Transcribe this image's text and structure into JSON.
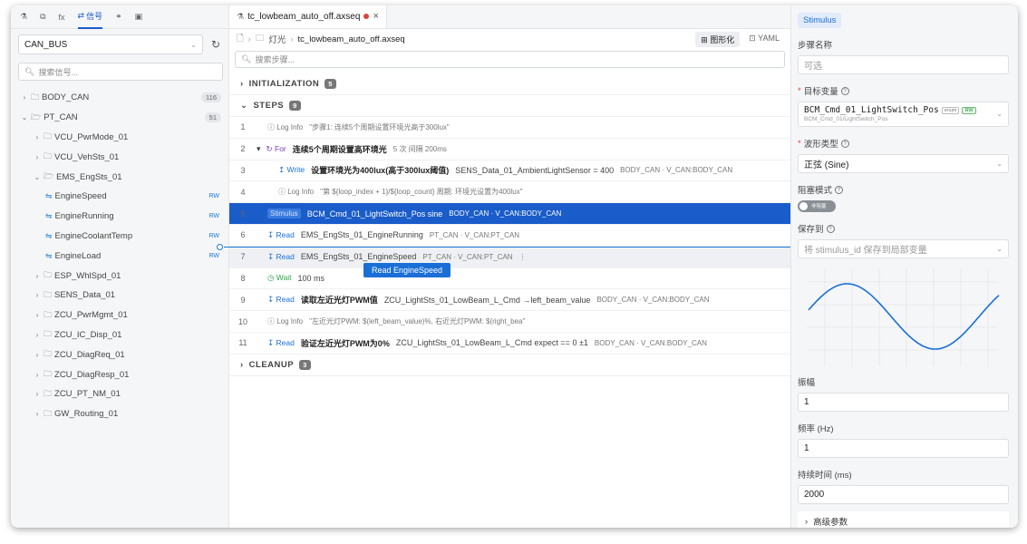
{
  "left": {
    "tabs": [
      {
        "icon": "flask-icon",
        "glyph": "⚗",
        "label": ""
      },
      {
        "icon": "copy-icon",
        "glyph": "⧉",
        "label": ""
      },
      {
        "icon": "function-icon",
        "glyph": "fx",
        "label": ""
      },
      {
        "icon": "signal-icon",
        "glyph": "⇄",
        "label": "信号"
      },
      {
        "icon": "share-icon",
        "glyph": "⚭",
        "label": ""
      },
      {
        "icon": "image-icon",
        "glyph": "▣",
        "label": ""
      }
    ],
    "bus_value": "CAN_BUS",
    "search_placeholder": "搜索信号...",
    "tree": [
      {
        "kind": "folder",
        "chev": "›",
        "label": "BODY_CAN",
        "count": "116",
        "indent": 0
      },
      {
        "kind": "folder-open",
        "chev": "⌄",
        "label": "PT_CAN",
        "count": "51",
        "indent": 0
      },
      {
        "kind": "folder",
        "chev": "›",
        "label": "VCU_PwrMode_01",
        "indent": 1
      },
      {
        "kind": "folder",
        "chev": "›",
        "label": "VCU_VehSts_01",
        "indent": 1
      },
      {
        "kind": "folder-open",
        "chev": "⌄",
        "label": "EMS_EngSts_01",
        "indent": 1
      },
      {
        "kind": "signal",
        "label": "EngineSpeed",
        "rw": "RW",
        "indent": 2
      },
      {
        "kind": "signal",
        "label": "EngineRunning",
        "rw": "RW",
        "indent": 2
      },
      {
        "kind": "signal",
        "label": "EngineCoolantTemp",
        "rw": "RW",
        "indent": 2
      },
      {
        "kind": "signal",
        "label": "EngineLoad",
        "rw": "RW",
        "indent": 2
      },
      {
        "kind": "folder",
        "chev": "›",
        "label": "ESP_WhlSpd_01",
        "indent": 1
      },
      {
        "kind": "folder",
        "chev": "›",
        "label": "SENS_Data_01",
        "indent": 1
      },
      {
        "kind": "folder",
        "chev": "›",
        "label": "ZCU_PwrMgmt_01",
        "indent": 1
      },
      {
        "kind": "folder",
        "chev": "›",
        "label": "ZCU_IC_Disp_01",
        "indent": 1
      },
      {
        "kind": "folder",
        "chev": "›",
        "label": "ZCU_DiagReq_01",
        "indent": 1
      },
      {
        "kind": "folder",
        "chev": "›",
        "label": "ZCU_DiagResp_01",
        "indent": 1
      },
      {
        "kind": "folder",
        "chev": "›",
        "label": "ZCU_PT_NM_01",
        "indent": 1
      },
      {
        "kind": "folder",
        "chev": "›",
        "label": "GW_Routing_01",
        "indent": 1
      }
    ]
  },
  "mid": {
    "file_tab": "tc_lowbeam_auto_off.axseq",
    "breadcrumb": [
      "灯光",
      "tc_lowbeam_auto_off.axseq"
    ],
    "view_graph": "图形化",
    "view_yaml": "YAML",
    "step_search_placeholder": "搜索步骤...",
    "sections": {
      "init": {
        "label": "INITIALIZATION",
        "count": "5"
      },
      "steps": {
        "label": "STEPS",
        "count": "9"
      },
      "cleanup": {
        "label": "CLEANUP",
        "count": "3"
      }
    },
    "steps": [
      {
        "num": "1",
        "parts": [
          {
            "t": "ⓘ Log Info",
            "c": "muted"
          },
          {
            "t": "\"步骤1: 连续5个周期设置环境光高于300lux\"",
            "c": "muted"
          }
        ],
        "indent": 1
      },
      {
        "num": "2",
        "prefix": "▾",
        "parts": [
          {
            "t": "↻ For",
            "c": "kw-purple"
          },
          {
            "t": "连续5个周期设置高环境光",
            "c": "bold"
          },
          {
            "t": "5 次  间隔 200ms",
            "c": "muted"
          }
        ],
        "indent": 0
      },
      {
        "num": "3",
        "parts": [
          {
            "t": "↥ Write",
            "c": "kw"
          },
          {
            "t": "设置环境光为400lux(高于300lux阈值)",
            "c": "bold"
          },
          {
            "t": "SENS_Data_01_AmbientLightSensor = 400",
            "c": ""
          },
          {
            "t": "BODY_CAN · V_CAN:BODY_CAN",
            "c": "muted"
          }
        ],
        "indent": 2
      },
      {
        "num": "4",
        "parts": [
          {
            "t": "ⓘ Log Info",
            "c": "muted"
          },
          {
            "t": "\"第 ${loop_index + 1}/${loop_count} 周期: 环境光设置为400lux\"",
            "c": "muted"
          }
        ],
        "indent": 2
      },
      {
        "num": "5",
        "selected": true,
        "parts": [
          {
            "t": "Stimulus",
            "c": "stimulus-tag"
          },
          {
            "t": "BCM_Cmd_01_LightSwitch_Pos sine",
            "c": ""
          },
          {
            "t": "BODY_CAN · V_CAN:BODY_CAN",
            "c": "muted"
          }
        ],
        "indent": 1
      },
      {
        "num": "6",
        "parts": [
          {
            "t": "↧ Read",
            "c": "kw"
          },
          {
            "t": "EMS_EngSts_01_EngineRunning",
            "c": ""
          },
          {
            "t": "PT_CAN · V_CAN:PT_CAN",
            "c": "muted"
          }
        ],
        "indent": 1
      },
      {
        "num": "7",
        "hover": true,
        "parts": [
          {
            "t": "↧ Read",
            "c": "kw"
          },
          {
            "t": "EMS_EngSts_01_EngineSpeed",
            "c": ""
          },
          {
            "t": "PT_CAN · V_CAN:PT_CAN",
            "c": "muted"
          },
          {
            "t": "⋮",
            "c": "muted"
          }
        ],
        "indent": 1
      },
      {
        "num": "8",
        "parts": [
          {
            "t": "◷ Wait",
            "c": "kw-green"
          },
          {
            "t": "100 ms",
            "c": ""
          }
        ],
        "indent": 1
      },
      {
        "num": "9",
        "parts": [
          {
            "t": "↧ Read",
            "c": "kw"
          },
          {
            "t": "读取左近光灯PWM值",
            "c": "bold"
          },
          {
            "t": "ZCU_LightSts_01_LowBeam_L_Cmd →left_beam_value",
            "c": ""
          },
          {
            "t": "BODY_CAN · V_CAN:BODY_CAN",
            "c": "muted"
          }
        ],
        "indent": 1
      },
      {
        "num": "10",
        "parts": [
          {
            "t": "ⓘ Log Info",
            "c": "muted"
          },
          {
            "t": "\"左近光灯PWM: $(left_beam_value)%, 右近光灯PWM: $(right_bea\"",
            "c": "muted"
          }
        ],
        "indent": 1
      },
      {
        "num": "11",
        "parts": [
          {
            "t": "↧ Read",
            "c": "kw"
          },
          {
            "t": "验证左近光灯PWM为0%",
            "c": "bold"
          },
          {
            "t": "ZCU_LightSts_01_LowBeam_L_Cmd expect == 0 ±1",
            "c": ""
          },
          {
            "t": "BODY_CAN · V_CAN:BODY_CAN",
            "c": "muted"
          }
        ],
        "indent": 1
      }
    ],
    "drag_tip": "Read EngineSpeed"
  },
  "right": {
    "header": "Stimulus",
    "step_name_label": "步骤名称",
    "step_name_placeholder": "可选",
    "target_label": "目标变量",
    "target_main": "BCM_Cmd_01_LightSwitch_Pos",
    "target_badge1": "enum",
    "target_badge2": "RW",
    "target_sub": "BCM_Cmd_01/LightSwitch_Pos",
    "wave_label": "波形类型",
    "wave_value": "正弦 (Sine)",
    "block_label": "阻塞模式",
    "block_toggle_text": "非阻塞",
    "save_label": "保存到",
    "save_placeholder": "将 stimulus_id 保存到局部变量",
    "amp_label": "振幅",
    "amp_value": "1",
    "freq_label": "频率 (Hz)",
    "freq_value": "1",
    "dur_label": "持续时间 (ms)",
    "dur_value": "2000",
    "advanced_label": "高级参数"
  }
}
